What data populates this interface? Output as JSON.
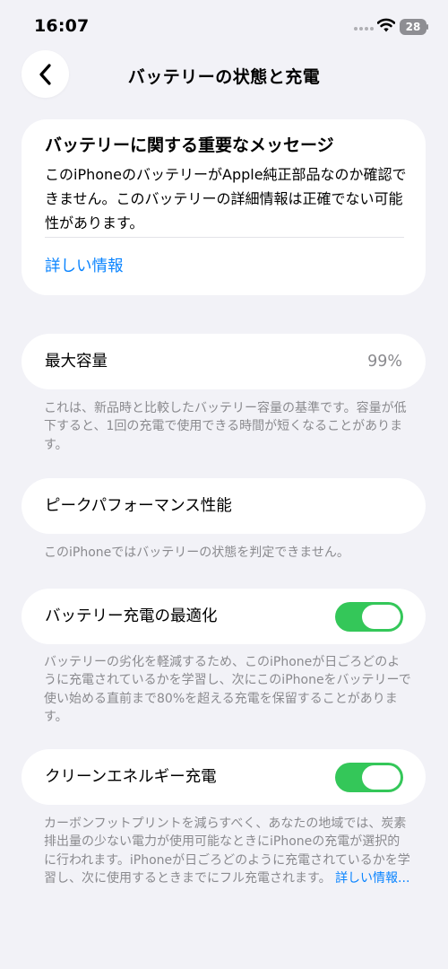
{
  "status_bar": {
    "time": "16:07",
    "battery_level": "28",
    "icons": [
      "signal-dots-icon",
      "wifi-icon",
      "battery-icon"
    ]
  },
  "nav": {
    "back_icon": "chevron-left-icon",
    "title": "バッテリーの状態と充電"
  },
  "message_card": {
    "title": "バッテリーに関する重要なメッセージ",
    "body": "このiPhoneのバッテリーがApple純正部品なのか確認できません。このバッテリーの詳細情報は正確でない可能性があります。",
    "link": "詳しい情報"
  },
  "max_capacity": {
    "label": "最大容量",
    "value": "99%",
    "footnote": "これは、新品時と比較したバッテリー容量の基準です。容量が低下すると、1回の充電で使用できる時間が短くなることがあります。"
  },
  "peak_performance": {
    "label": "ピークパフォーマンス性能",
    "footnote": "このiPhoneではバッテリーの状態を判定できません。"
  },
  "optimized_charging": {
    "label": "バッテリー充電の最適化",
    "enabled": true,
    "footnote": "バッテリーの劣化を軽減するため、このiPhoneが日ごろどのように充電されているかを学習し、次にこのiPhoneをバッテリーで使い始める直前まで80%を超える充電を保留することがあります。"
  },
  "clean_energy": {
    "label": "クリーンエネルギー充電",
    "enabled": true,
    "footnote": "カーボンフットプリントを減らすべく、あなたの地域では、炭素排出量の少ない電力が使用可能なときにiPhoneの充電が選択的に行われます。iPhoneが日ごろどのように充電されているかを学習し、次に使用するときまでにフル充電されます。",
    "footnote_link": "詳しい情報..."
  },
  "colors": {
    "accent": "#0a84ff",
    "toggle_on": "#34c759",
    "background": "#f2f2f7",
    "secondary_text": "#8a8a8e"
  }
}
